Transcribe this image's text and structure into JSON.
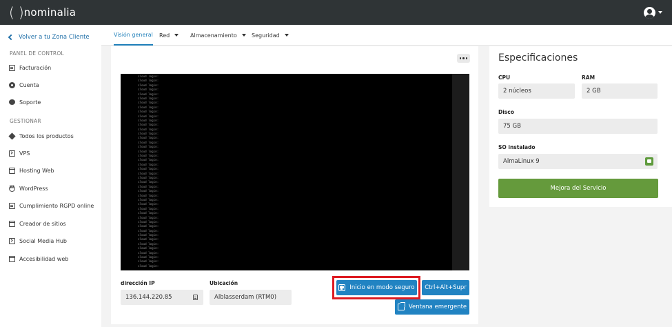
{
  "brand": {
    "paren_left": "(",
    "paren_right": ")",
    "name": "nominalia"
  },
  "user": {
    "icon": "user-avatar-icon"
  },
  "sidebar": {
    "back_label": "Volver a tu Zona Cliente",
    "panel_section": "PANEL DE CONTROL",
    "panel_items": [
      {
        "label": "Facturación",
        "icon": "invoice-icon"
      },
      {
        "label": "Cuenta",
        "icon": "gear-icon"
      },
      {
        "label": "Soporte",
        "icon": "chat-icon"
      }
    ],
    "manage_section": "GESTIONAR",
    "manage_items": [
      {
        "label": "Todos los productos",
        "icon": "cube-icon"
      },
      {
        "label": "VPS",
        "icon": "terminal-icon"
      },
      {
        "label": "Hosting Web",
        "icon": "window-icon"
      },
      {
        "label": "WordPress",
        "icon": "wordpress-icon"
      },
      {
        "label": "Cumplimiento RGPD online",
        "icon": "document-icon"
      },
      {
        "label": "Creador de sitios",
        "icon": "builder-icon"
      },
      {
        "label": "Social Media Hub",
        "icon": "social-icon"
      },
      {
        "label": "Accesibilidad web",
        "icon": "accessibility-icon"
      }
    ]
  },
  "tabs": [
    {
      "label": "Visión general",
      "active": true
    },
    {
      "label": "Red",
      "dropdown": true
    },
    {
      "label": "Almacenamiento",
      "dropdown": true
    },
    {
      "label": "Seguridad",
      "dropdown": true
    }
  ],
  "console": {
    "line_text": "cloud login:",
    "line_count": 44
  },
  "ip": {
    "label": "dirección IP",
    "value": "136.144.220.85"
  },
  "location": {
    "label": "Ubicación",
    "value": "Alblasserdam (RTM0)"
  },
  "buttons": {
    "safe_mode": "Inicio en modo seguro",
    "ctrl_alt_del": "Ctrl+Alt+Supr",
    "popup": "Ventana emergente"
  },
  "specs": {
    "title": "Especificaciones",
    "cpu_label": "CPU",
    "cpu_value": "2 núcleos",
    "ram_label": "RAM",
    "ram_value": "2 GB",
    "disk_label": "Disco",
    "disk_value": "75 GB",
    "os_label": "SO instalado",
    "os_value": "AlmaLinux 9",
    "upgrade_label": "Mejora del Servicio"
  },
  "colors": {
    "topbar": "#2f3436",
    "accent": "#2183c2",
    "highlight": "#dd1b22",
    "upgrade": "#659a3c"
  }
}
